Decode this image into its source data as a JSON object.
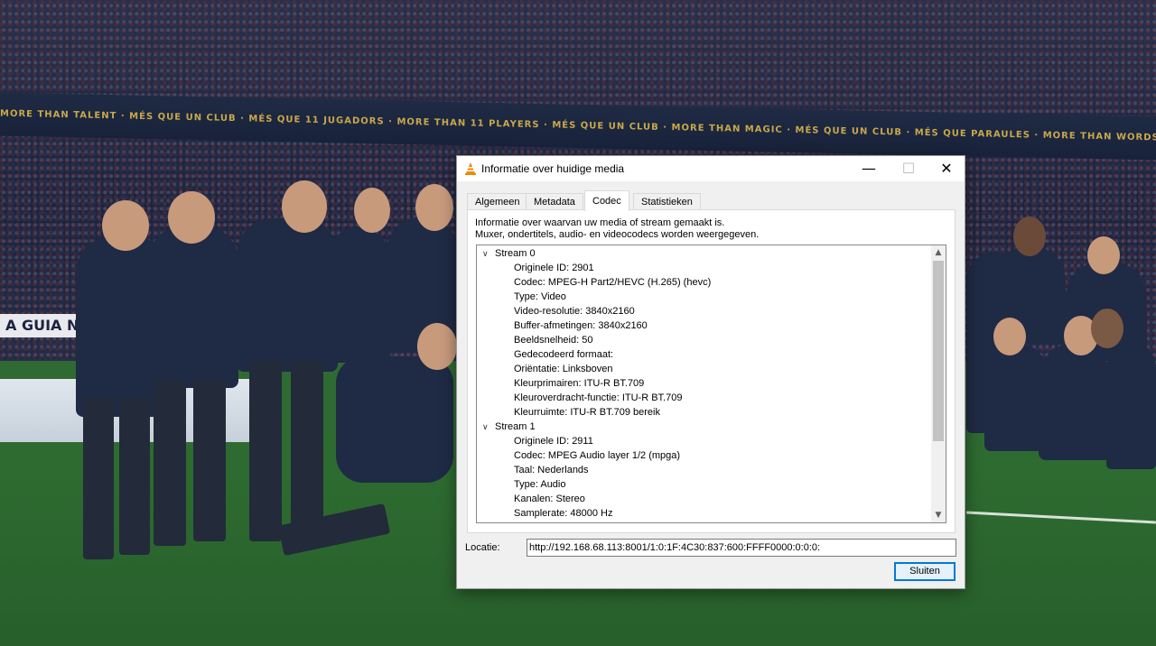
{
  "window": {
    "title": "Informatie over huidige media",
    "minimize_glyph": "—",
    "maximize_glyph": "☐",
    "close_glyph": "✕"
  },
  "tabs": [
    {
      "label": "Algemeen",
      "active": false
    },
    {
      "label": "Metadata",
      "active": false
    },
    {
      "label": "Codec",
      "active": true
    },
    {
      "label": "Statistieken",
      "active": false
    }
  ],
  "codec_panel": {
    "description_line1": "Informatie over waarvan uw media of stream gemaakt is.",
    "description_line2": "Muxer, ondertitels, audio- en videocodecs worden weergegeven.",
    "streams": [
      {
        "label": "Stream 0",
        "properties": [
          "Originele ID: 2901",
          "Codec: MPEG-H Part2/HEVC (H.265) (hevc)",
          "Type: Video",
          "Video-resolutie: 3840x2160",
          "Buffer-afmetingen: 3840x2160",
          "Beeldsnelheid: 50",
          "Gedecodeerd formaat:",
          "Oriëntatie: Linksboven",
          "Kleurprimairen: ITU-R BT.709",
          "Kleuroverdracht-functie: ITU-R BT.709",
          "Kleurruimte: ITU-R BT.709 bereik"
        ]
      },
      {
        "label": "Stream 1",
        "properties": [
          "Originele ID: 2911",
          "Codec: MPEG Audio layer 1/2 (mpga)",
          "Taal: Nederlands",
          "Type: Audio",
          "Kanalen: Stereo",
          "Samplerate: 48000 Hz"
        ]
      }
    ]
  },
  "location": {
    "label": "Locatie:",
    "value": "http://192.168.68.113:8001/1:0:1F:4C30:837:600:FFFF0000:0:0:0:"
  },
  "close_button_label": "Sluiten",
  "background": {
    "ad_board_text": "A GUIA NIKE",
    "banner_text": "MORE THAN TALENT · MÉS QUE UN CLUB · MÉS QUE 11 JUGADORS · MORE THAN 11 PLAYERS · MÉS QUE UN CLUB · MORE THAN MAGIC · MÉS QUE UN CLUB · MÉS QUE PARAULES · MORE THAN WORDS · MÉS QUE GUANYAR O PERDRE · MORE THAN"
  },
  "icons": {
    "app": "vlc-cone-icon",
    "tree_expanded": "chevron-down-icon",
    "scroll_up": "scroll-up-arrow-icon",
    "scroll_down": "scroll-down-arrow-icon"
  },
  "colors": {
    "accent": "#0078d7",
    "vlc_orange": "#f08a00"
  }
}
